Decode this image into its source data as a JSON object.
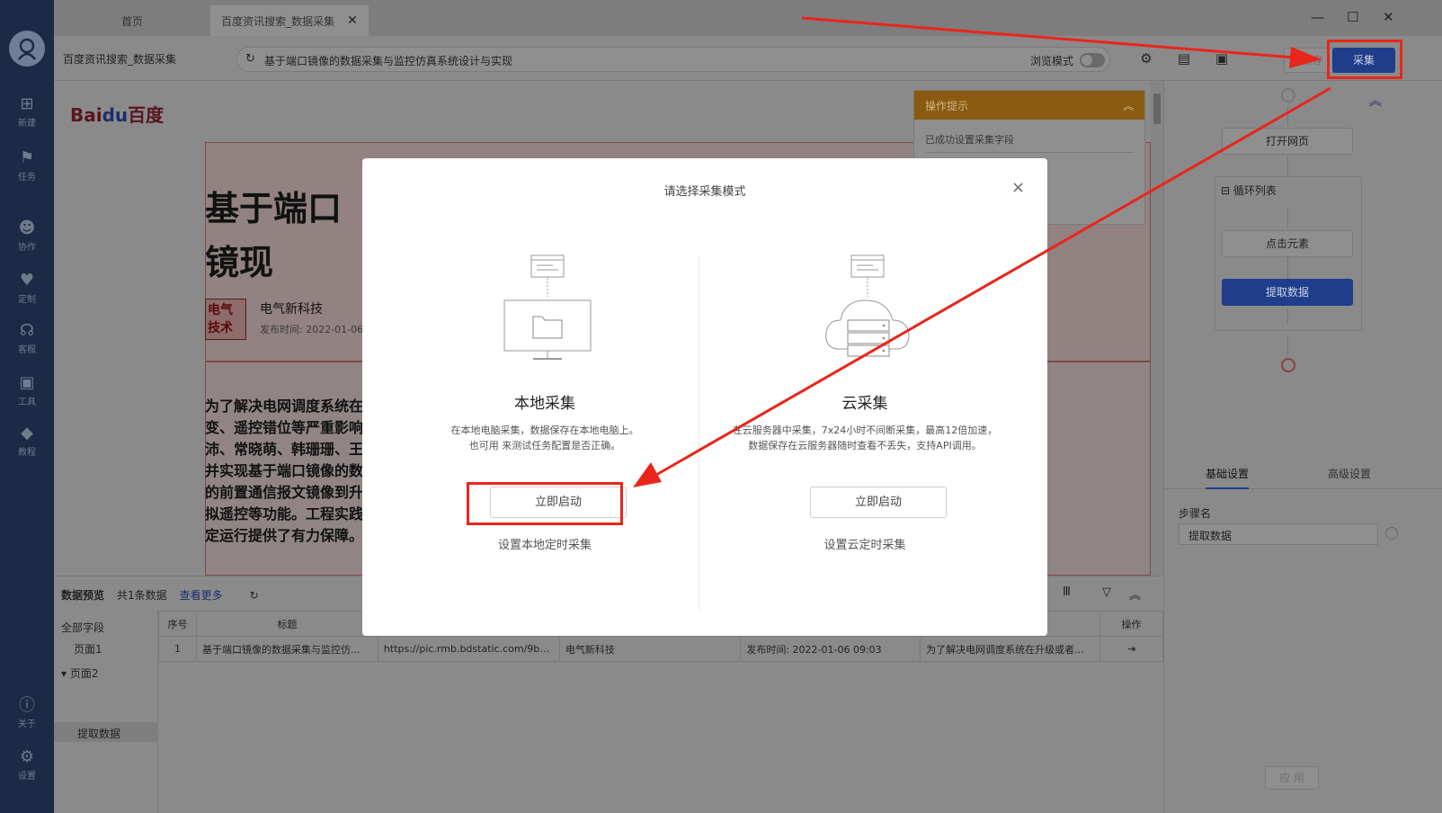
{
  "nav": {
    "items": [
      {
        "label": "新建",
        "icon": "plus-icon"
      },
      {
        "label": "任务",
        "icon": "task-icon"
      },
      {
        "label": "协作",
        "icon": "collab-icon"
      },
      {
        "label": "定制",
        "icon": "custom-icon"
      },
      {
        "label": "客服",
        "icon": "headset-icon"
      },
      {
        "label": "工具",
        "icon": "toolbox-icon"
      },
      {
        "label": "教程",
        "icon": "tutorial-icon"
      }
    ],
    "about": "关于",
    "settings": "设置"
  },
  "tabs": {
    "home": "首页",
    "active": "百度资讯搜索_数据采集",
    "close": "✕"
  },
  "window": {
    "minimize": "—",
    "maximize": "☐",
    "close": "✕"
  },
  "toolbar": {
    "task_name": "百度资讯搜索_数据采集",
    "url": "基于端口镜像的数据采集与监控仿真系统设计与实现",
    "browse_mode": "浏览模式",
    "save": "保存",
    "collect": "采集"
  },
  "page": {
    "logo_bai": "Bai",
    "logo_du": "du",
    "logo_text": "百度",
    "headline": "基于端口镜现",
    "author_img_text": "电气技术",
    "author": "电气新科技",
    "pubtime": "发布时间: 2022-01-06",
    "body": "为了解决电网调度系统在变、遥控错位等严重影响沛、常晓萌、韩珊珊、王并实现基于端口镜像的数的前置通信报文镜像到升拟遥控等功能。工程实践定运行提供了有力保障。"
  },
  "tips": {
    "title": "操作提示",
    "text": "已成功设置采集字段"
  },
  "flow": {
    "open_page": "打开网页",
    "loop": "循环列表",
    "click": "点击元素",
    "extract": "提取数据",
    "tab_basic": "基础设置",
    "tab_advanced": "高级设置",
    "step_label": "步骤名",
    "step_value": "提取数据",
    "apply": "应 用"
  },
  "preview": {
    "title": "数据预览",
    "count": "共1条数据",
    "more": "查看更多",
    "fields_all": "全部字段",
    "page1": "页面1",
    "page2": "页面2",
    "extract": "提取数据",
    "columns": [
      "序号",
      "标题",
      "",
      "",
      "",
      "",
      "操作"
    ],
    "row": [
      "1",
      "基于端口镜像的数据采集与监控仿...",
      "https://pic.rmb.bdstatic.com/9b5e...",
      "电气新科技",
      "发布时间: 2022-01-06 09:03",
      "为了解决电网调度系统在升级或者..."
    ]
  },
  "modal": {
    "title": "请选择采集模式",
    "close": "×",
    "local": {
      "title": "本地采集",
      "desc1": "在本地电脑采集，数据保存在本地电脑上。",
      "desc2": "也可用 来测试任务配置是否正确。",
      "start": "立即启动",
      "schedule": "设置本地定时采集"
    },
    "cloud": {
      "title": "云采集",
      "desc1": "在云服务器中采集，7x24小时不间断采集，最高12倍加速，",
      "desc2": "数据保存在云服务器随时查看不丢失，支持API调用。",
      "start": "立即启动",
      "schedule": "设置云定时采集"
    }
  },
  "colors": {
    "annotation": "#e8261c",
    "primary": "#1f3d8a"
  }
}
